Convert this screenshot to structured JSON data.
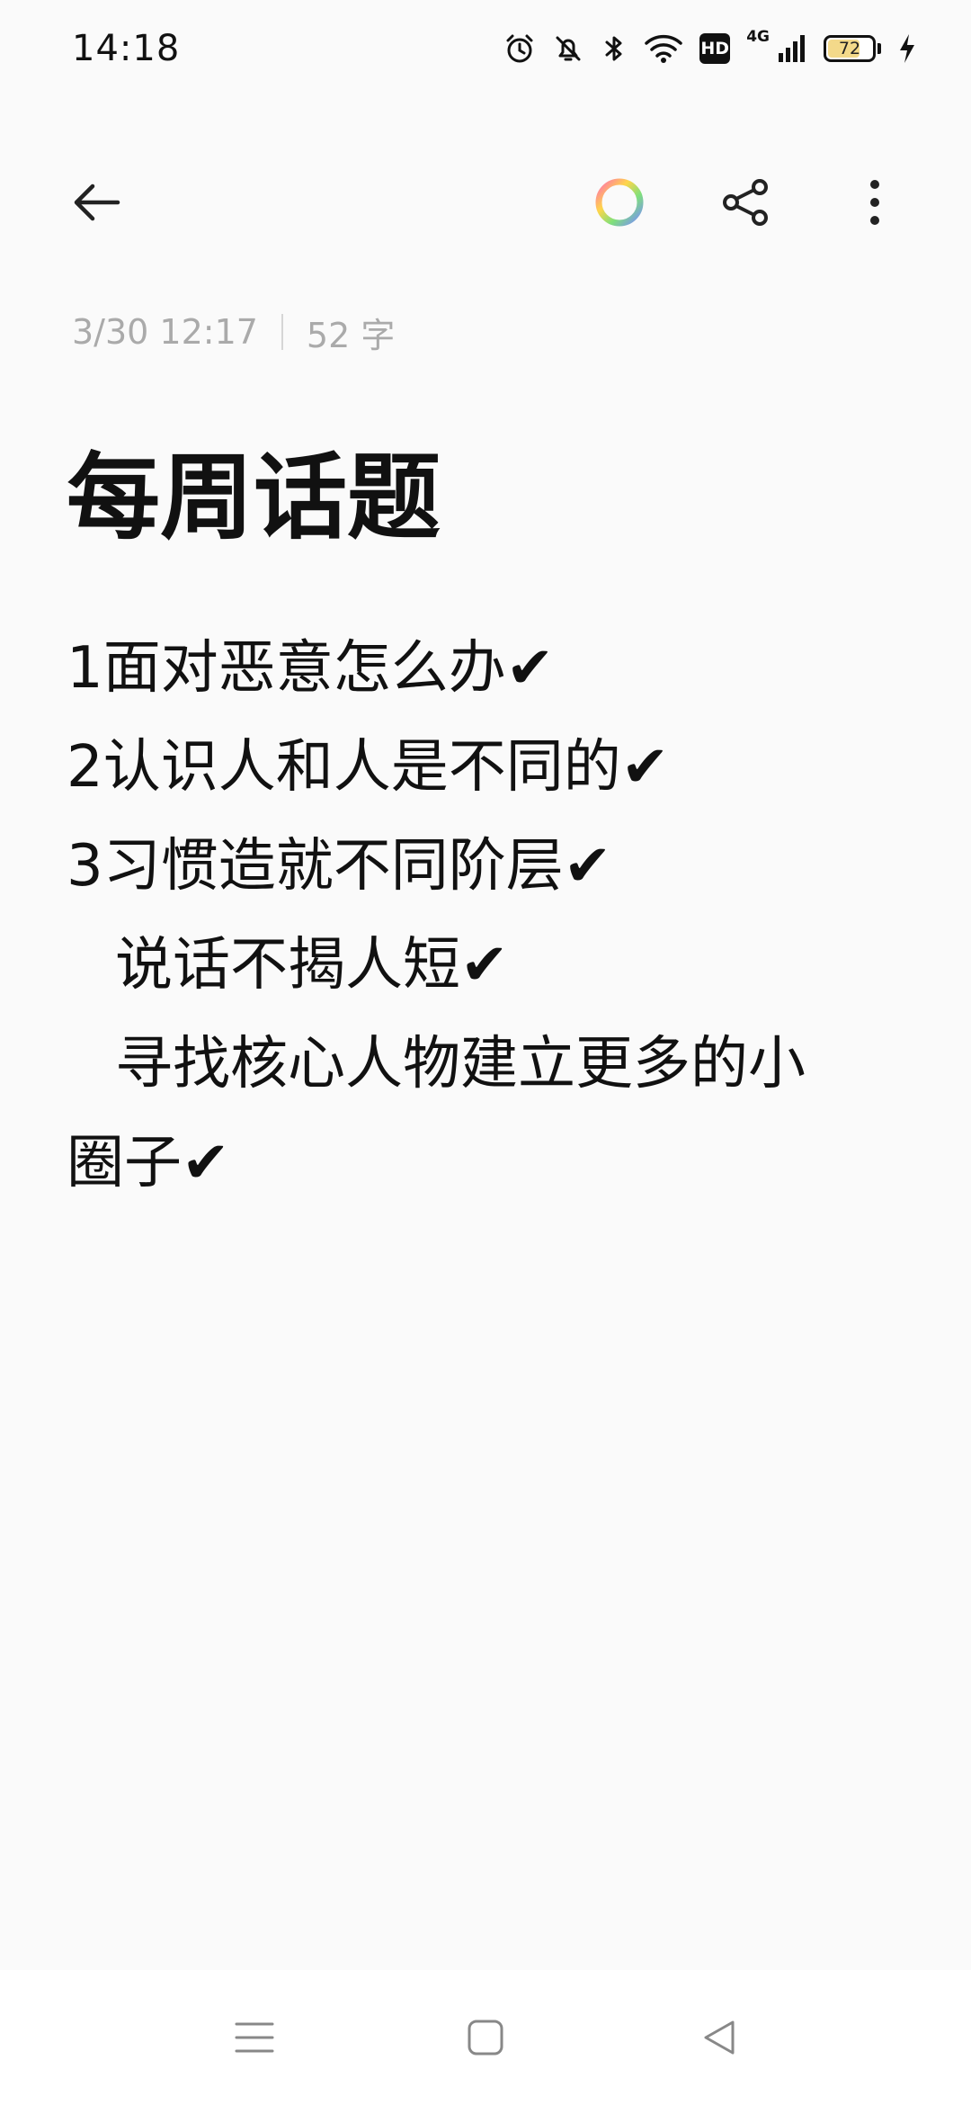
{
  "status_bar": {
    "time": "14:18",
    "hd_label": "HD",
    "network_label": "4G",
    "battery_level": "72",
    "battery_fraction": 0.72,
    "icons": [
      "alarm-icon",
      "mute-bell-icon",
      "bluetooth-icon",
      "wifi-icon",
      "hd-badge",
      "signal-icon",
      "battery-icon",
      "charging-icon"
    ]
  },
  "toolbar": {
    "icons": [
      "back-arrow-icon",
      "color-ring-icon",
      "share-icon",
      "more-vertical-icon"
    ]
  },
  "note": {
    "date": "3/30 12:17",
    "word_count": "52 字",
    "title": "每周话题",
    "lines": [
      "1面对恶意怎么办✔",
      "2认识人和人是不同的✔",
      "3习惯造就不同阶层✔",
      "说话不揭人短✔",
      "寻找核心人物建立更多的小",
      "圈子✔"
    ]
  },
  "nav_bar": {
    "icons": [
      "menu-icon",
      "home-square-icon",
      "back-triangle-icon"
    ]
  },
  "colors": {
    "background": "#fafafa",
    "text": "#111111",
    "meta_text": "#aaaaaa",
    "battery_fill": "#f3d98a"
  }
}
